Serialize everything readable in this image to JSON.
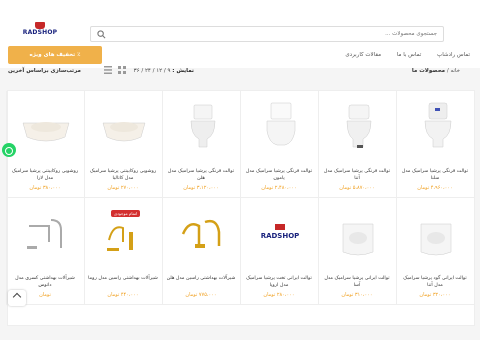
{
  "header": {
    "logo_text": "RADSHOP",
    "search_placeholder": "جستجوی محصولات ...",
    "nav": [
      "تماس با ما",
      "مقالات کاربردی",
      "تماس با ما"
    ],
    "nav_items": [
      "تماس با ما",
      "تماس رادشاپ",
      "مقالات کاربردی"
    ],
    "promo_label": "٪ تخفیف های ویژه"
  },
  "toolbar": {
    "breadcrumb_home": "خانه",
    "breadcrumb_sep": "/",
    "breadcrumb_current": "محصولات ما",
    "showing_prefix": "نمایش :",
    "showing_values": "۹ / ۱۲ / ۲۴ / ۳۶",
    "sort_label": "مرتب‌سازی براساس آخرین"
  },
  "products": [
    {
      "title": "توالت فرنگی پرشیا سرامیک مدل سلنا",
      "price": "۴،۹۶۰،۰۰۰ تومان"
    },
    {
      "title": "توالت فرنگی پرشیا سرامیک مدل آتنا",
      "price": "۵،۸۷۰،۰۰۰ تومان"
    },
    {
      "title": "توالت فرنگی پرشیا سرامیک مدل پامون",
      "price": "۲،۴۸۰،۰۰۰ تومان"
    },
    {
      "title": "توالت فرنگی پرشیا سرامیک مدل هلن",
      "price": "۳،۱۲۰،۰۰۰ تومان"
    },
    {
      "title": "روشویی روکابینتی پرشیا سرامیک مدل کاتالیا",
      "price": "۲۷۰،۰۰۰ تومان"
    },
    {
      "title": "روشویی روکابینتی پرشیا سرامیک مدل لارا",
      "price": "۳۸۰،۰۰۰ تومان"
    },
    {
      "title": "توالت ایرانی گود پرشیا سرامیک مدل آتنا",
      "price": "۳۲۰،۰۰۰ تومان"
    },
    {
      "title": "توالت ایرانی پرشیا سرامیک مدل آسا",
      "price": "۳۱۰،۰۰۰ تومان"
    },
    {
      "title": "توالت ایرانی تخت پرشیا سرامیک مدل اروپا",
      "price": "۲۸۰،۰۰۰ تومان"
    },
    {
      "title": "شیرآلات بهداشتی راسین مدل هلن",
      "price": "۷۷۵،۰۰۰ تومان"
    },
    {
      "title": "شیرآلات بهداشتی راسین مدل روما",
      "price": "۴۴۰،۰۰۰ تومان"
    },
    {
      "title": "شیرآلات بهداشتی کسری مدل داتوس",
      "price": "تومان"
    }
  ],
  "badge_text": "اتمام موجودی",
  "grid_logo_text": "RADSHOP"
}
